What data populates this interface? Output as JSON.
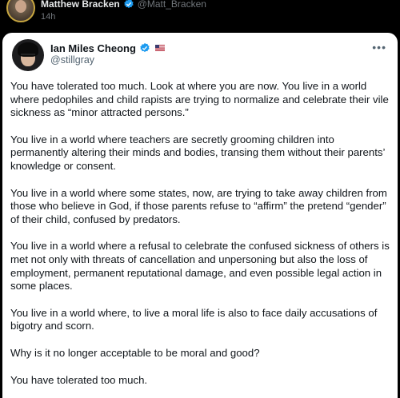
{
  "outer_tweet": {
    "author_name": "Matthew Bracken",
    "handle": "@Matt_Bracken",
    "time": "14h",
    "verified_color": "#1d9bf0"
  },
  "quoted_tweet": {
    "author_name": "Ian Miles Cheong",
    "handle": "@stillgray",
    "verified_color": "#1d9bf0",
    "more_label": "•••",
    "paragraphs": [
      "You have tolerated too much. Look at where you are now. You live in a world where pedophiles and child rapists are trying to normalize and celebrate their vile sickness as “minor attracted persons.”",
      "You live in a world where teachers are secretly grooming children into permanently altering their minds and bodies, transing them without their parents’ knowledge or consent.",
      "You live in a world where some states, now, are trying to take away children from those who believe in God, if those parents refuse to “affirm” the pretend “gender” of their child, confused by predators.",
      "You live in a world where a refusal to celebrate the confused sickness of others is met not only with threats of cancellation and unpersoning but also the loss of employment, permanent reputational damage, and even possible legal action in some places.",
      "You live in a world where, to live a moral life is also to face daily accusations of bigotry and scorn.",
      "Why is it no longer acceptable to be moral and good?",
      "You have tolerated too much."
    ]
  }
}
